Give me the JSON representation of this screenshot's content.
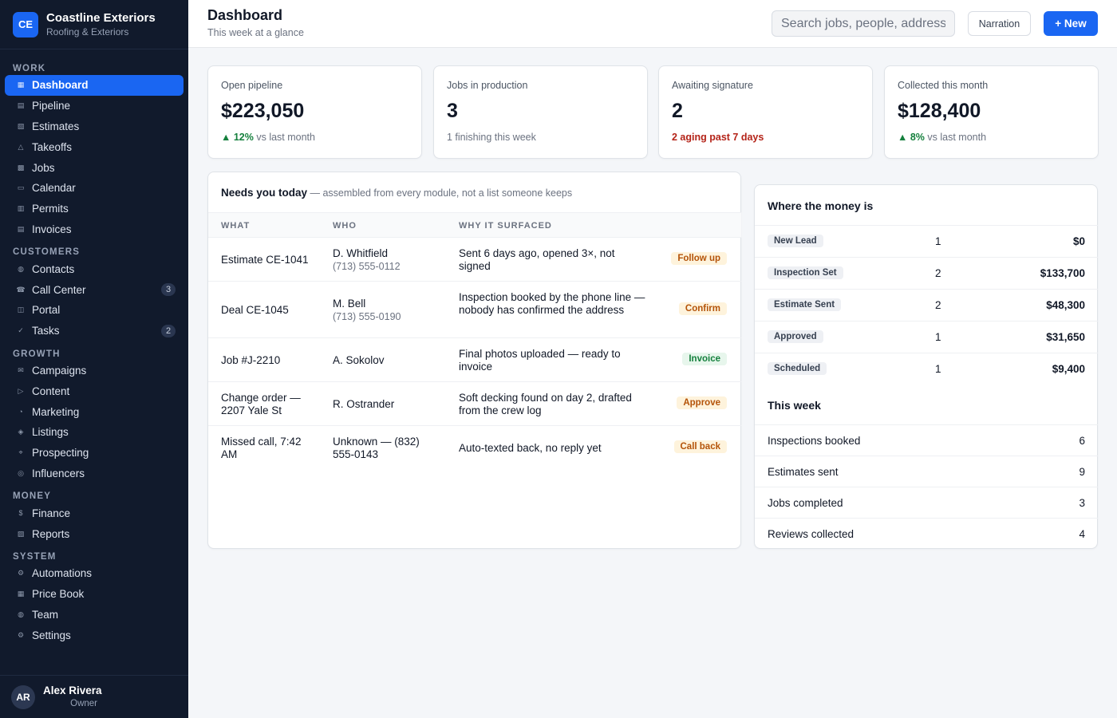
{
  "brand": {
    "logo": "CE",
    "name": "Coastline Exteriors",
    "subtitle": "Roofing & Exteriors"
  },
  "nav": {
    "sections": [
      {
        "title": "WORK",
        "items": [
          {
            "label": "Dashboard",
            "icon": "▦",
            "active": true
          },
          {
            "label": "Pipeline",
            "icon": "▤"
          },
          {
            "label": "Estimates",
            "icon": "▧"
          },
          {
            "label": "Takeoffs",
            "icon": "△"
          },
          {
            "label": "Jobs",
            "icon": "▩"
          },
          {
            "label": "Calendar",
            "icon": "▭"
          },
          {
            "label": "Permits",
            "icon": "▥"
          },
          {
            "label": "Invoices",
            "icon": "▤"
          }
        ]
      },
      {
        "title": "CUSTOMERS",
        "items": [
          {
            "label": "Contacts",
            "icon": "◍"
          },
          {
            "label": "Call Center",
            "icon": "☎",
            "badge": "3"
          },
          {
            "label": "Portal",
            "icon": "◫"
          },
          {
            "label": "Tasks",
            "icon": "✓",
            "badge": "2"
          }
        ]
      },
      {
        "title": "GROWTH",
        "items": [
          {
            "label": "Campaigns",
            "icon": "✉"
          },
          {
            "label": "Content",
            "icon": "▷"
          },
          {
            "label": "Marketing",
            "icon": "◔"
          },
          {
            "label": "Listings",
            "icon": "◈"
          },
          {
            "label": "Prospecting",
            "icon": "⌖"
          },
          {
            "label": "Influencers",
            "icon": "◎"
          }
        ]
      },
      {
        "title": "MONEY",
        "items": [
          {
            "label": "Finance",
            "icon": "$"
          },
          {
            "label": "Reports",
            "icon": "▨"
          }
        ]
      },
      {
        "title": "SYSTEM",
        "items": [
          {
            "label": "Automations",
            "icon": "⚙"
          },
          {
            "label": "Price Book",
            "icon": "▦"
          },
          {
            "label": "Team",
            "icon": "◍"
          },
          {
            "label": "Settings",
            "icon": "⚙"
          }
        ]
      }
    ]
  },
  "user": {
    "initials": "AR",
    "name": "Alex Rivera",
    "role": "Owner"
  },
  "header": {
    "title": "Dashboard",
    "subtitle": "This week at a glance",
    "search_placeholder": "Search jobs, people, addresses",
    "narration_label": "Narration",
    "new_label": "+ New"
  },
  "stats": [
    {
      "label": "Open pipeline",
      "value": "$223,050",
      "delta": "▲ 12%",
      "note": " vs last month",
      "tone": "up"
    },
    {
      "label": "Jobs in production",
      "value": "3",
      "delta": "",
      "note": "1 finishing this week",
      "tone": "muted"
    },
    {
      "label": "Awaiting signature",
      "value": "2",
      "delta": "2 aging past 7 days",
      "note": "",
      "tone": "warn"
    },
    {
      "label": "Collected this month",
      "value": "$128,400",
      "delta": "▲ 8%",
      "note": " vs last month",
      "tone": "up"
    }
  ],
  "needs": {
    "title": "Needs you today",
    "subtitle": " — assembled from every module, not a list someone keeps",
    "columns": [
      "WHAT",
      "WHO",
      "WHY IT SURFACED"
    ],
    "rows": [
      {
        "what": "Estimate CE-1041",
        "who": "D. Whitfield",
        "phone": "(713) 555-0112",
        "why": "Sent 6 days ago, opened 3×, not signed",
        "action": "Follow up",
        "tone": "amber"
      },
      {
        "what": "Deal CE-1045",
        "who": "M. Bell",
        "phone": "(713) 555-0190",
        "why": "Inspection booked by the phone line — nobody has confirmed the address",
        "action": "Confirm",
        "tone": "amber"
      },
      {
        "what": "Job #J-2210",
        "who": "A. Sokolov",
        "phone": "",
        "why": "Final photos uploaded — ready to invoice",
        "action": "Invoice",
        "tone": "green"
      },
      {
        "what": "Change order — 2207 Yale St",
        "who": "R. Ostrander",
        "phone": "",
        "why": "Soft decking found on day 2, drafted from the crew log",
        "action": "Approve",
        "tone": "amber"
      },
      {
        "what": "Missed call, 7:42 AM",
        "who": "Unknown — (832) 555-0143",
        "phone": "",
        "why": "Auto-texted back, no reply yet",
        "action": "Call back",
        "tone": "amber"
      }
    ]
  },
  "money": {
    "title": "Where the money is",
    "stages": [
      {
        "name": "New Lead",
        "count": "1",
        "amount": "$0"
      },
      {
        "name": "Inspection Set",
        "count": "2",
        "amount": "$133,700"
      },
      {
        "name": "Estimate Sent",
        "count": "2",
        "amount": "$48,300"
      },
      {
        "name": "Approved",
        "count": "1",
        "amount": "$31,650"
      },
      {
        "name": "Scheduled",
        "count": "1",
        "amount": "$9,400"
      }
    ],
    "week_title": "This week",
    "week": [
      {
        "label": "Inspections booked",
        "value": "6"
      },
      {
        "label": "Estimates sent",
        "value": "9"
      },
      {
        "label": "Jobs completed",
        "value": "3"
      },
      {
        "label": "Reviews collected",
        "value": "4"
      }
    ]
  },
  "colors": {
    "accent": "#1a66f2",
    "sidebar": "#111a2c",
    "success": "#15803d",
    "danger": "#b42318",
    "amber_bg": "#fef3dc",
    "amber_text": "#b45309",
    "green_bg": "#e7f6ec",
    "green_text": "#15803d"
  }
}
